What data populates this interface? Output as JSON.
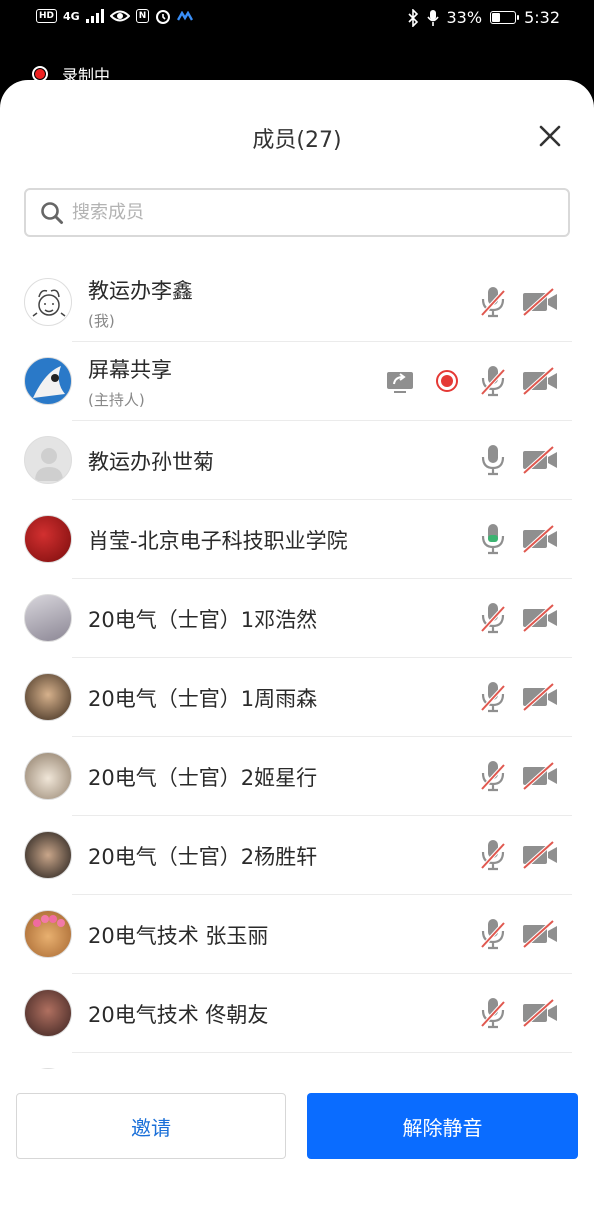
{
  "status_bar": {
    "network": "4G",
    "battery": "33%",
    "time": "5:32"
  },
  "recording": {
    "label": "录制中"
  },
  "sheet": {
    "title": "成员(27)"
  },
  "search": {
    "placeholder": "搜索成员"
  },
  "members": [
    {
      "name": "教运办李鑫",
      "tag": "(我)",
      "mic": "muted",
      "camera": "off"
    },
    {
      "name": "屏幕共享",
      "tag": "(主持人)",
      "mic": "muted",
      "camera": "off",
      "sharing": true,
      "recording": true
    },
    {
      "name": "教运办孙世菊",
      "mic": "off",
      "camera": "off"
    },
    {
      "name": "肖莹-北京电子科技职业学院",
      "mic": "on",
      "camera": "off"
    },
    {
      "name": "20电气（士官）1邓浩然",
      "mic": "muted",
      "camera": "off"
    },
    {
      "name": "20电气（士官）1周雨森",
      "mic": "muted",
      "camera": "off"
    },
    {
      "name": "20电气（士官）2姬星行",
      "mic": "muted",
      "camera": "off"
    },
    {
      "name": "20电气（士官）2杨胜轩",
      "mic": "muted",
      "camera": "off"
    },
    {
      "name": "20电气技术  张玉丽",
      "mic": "muted",
      "camera": "off"
    },
    {
      "name": "20电气技术 佟朝友",
      "mic": "muted",
      "camera": "off"
    }
  ],
  "buttons": {
    "invite": "邀请",
    "unmute_all": "解除静音"
  },
  "colors": {
    "accent": "#0a6cff",
    "muted_slash": "#e0584f",
    "icon_gray": "#8f8f8f",
    "record_red": "#e53935"
  }
}
